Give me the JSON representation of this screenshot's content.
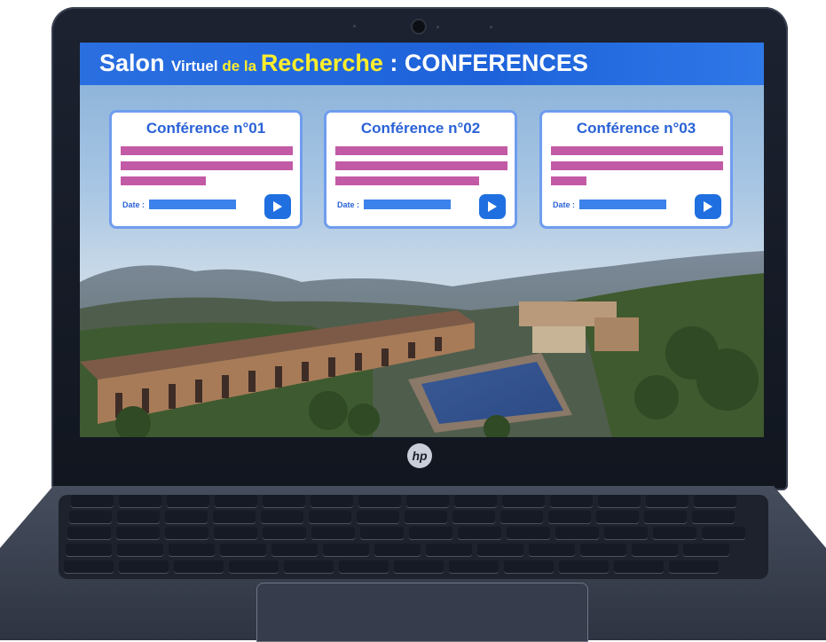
{
  "page": {
    "title_parts": [
      {
        "text": "Salon ",
        "size": "big",
        "color": "white"
      },
      {
        "text": "Virtuel ",
        "size": "small",
        "color": "white"
      },
      {
        "text": "de la ",
        "size": "small",
        "color": "yellow"
      },
      {
        "text": "Recherche",
        "size": "big",
        "color": "yellow"
      },
      {
        "text": " : CONFERENCES",
        "size": "big",
        "color": "white"
      }
    ]
  },
  "conferences": [
    {
      "title": "Conférence n°01",
      "date_label": "Date :",
      "play_icon": "play-icon"
    },
    {
      "title": "Conférence n°02",
      "date_label": "Date :",
      "play_icon": "play-icon"
    },
    {
      "title": "Conférence n°03",
      "date_label": "Date :",
      "play_icon": "play-icon"
    }
  ],
  "laptop": {
    "brand_logo": "hp"
  },
  "colors": {
    "title_bar": "#1d62da",
    "title_yellow": "#ffee2b",
    "card_border": "#6f9dee",
    "card_title": "#2a62d6",
    "placeholder_bar": "#c35aa6",
    "date_bar": "#3b82ea",
    "play_button": "#1f6fe0"
  }
}
